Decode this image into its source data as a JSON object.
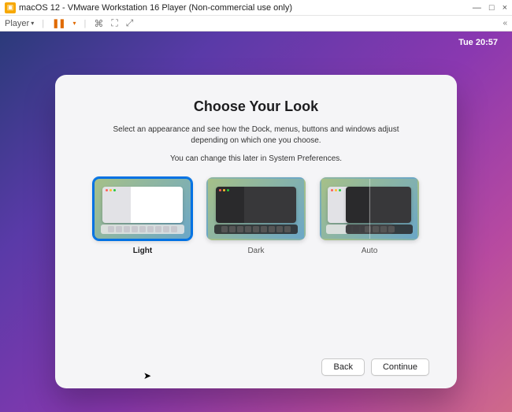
{
  "host": {
    "title": "macOS 12 - VMware Workstation 16 Player (Non-commercial use only)",
    "player_menu_label": "Player",
    "minimize": "—",
    "maximize": "□",
    "close": "×"
  },
  "guest": {
    "clock": "Tue 20:57"
  },
  "setup": {
    "heading": "Choose Your Look",
    "subtitle": "Select an appearance and see how the Dock, menus, buttons and windows adjust depending on which one you choose.",
    "note": "You can change this later in System Preferences.",
    "options": [
      {
        "id": "light",
        "label": "Light",
        "selected": true
      },
      {
        "id": "dark",
        "label": "Dark",
        "selected": false
      },
      {
        "id": "auto",
        "label": "Auto",
        "selected": false
      }
    ],
    "back_label": "Back",
    "continue_label": "Continue"
  }
}
